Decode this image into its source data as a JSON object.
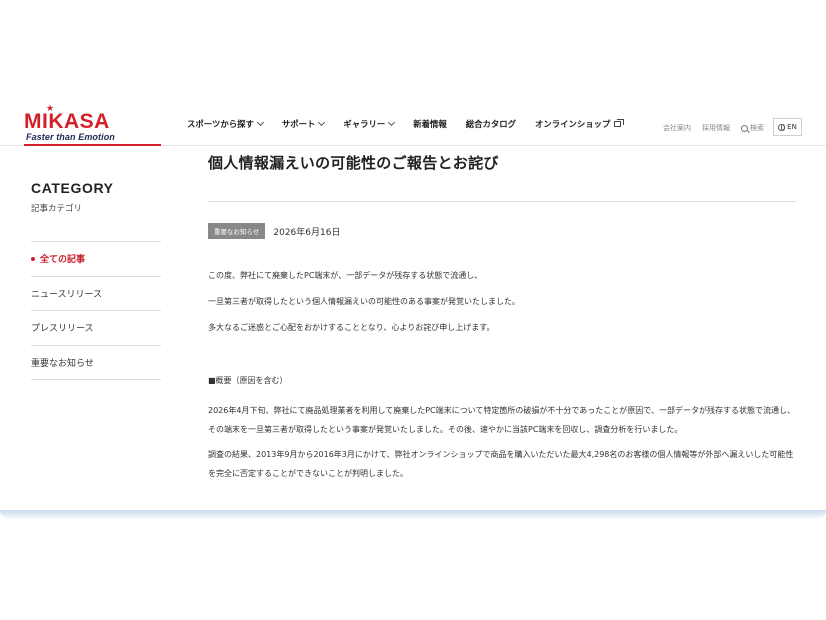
{
  "brand": {
    "logo_text": "MIKASA",
    "tagline": "Faster than Emotion",
    "color": "#d3202a"
  },
  "nav": {
    "items": [
      {
        "label": "スポーツから探す",
        "has_dropdown": true
      },
      {
        "label": "サポート",
        "has_dropdown": true
      },
      {
        "label": "ギャラリー",
        "has_dropdown": true
      },
      {
        "label": "新着情報",
        "has_dropdown": false
      },
      {
        "label": "総合カタログ",
        "has_dropdown": false
      },
      {
        "label": "オンラインショップ",
        "has_dropdown": false,
        "external": true
      }
    ]
  },
  "utility": {
    "company": "会社案内",
    "recruit": "採用情報",
    "search": "検索",
    "lang": "EN"
  },
  "sidebar": {
    "title": "CATEGORY",
    "subtitle": "記事カテゴリ",
    "items": [
      {
        "label": "全ての記事",
        "active": true
      },
      {
        "label": "ニュースリリース",
        "active": false
      },
      {
        "label": "プレスリリース",
        "active": false
      },
      {
        "label": "重要なお知らせ",
        "active": false
      }
    ]
  },
  "article": {
    "title": "個人情報漏えいの可能性のご報告とお詫び",
    "badge": "重要なお知らせ",
    "date": "2026年6月16日",
    "intro": [
      "この度、弊社にて廃棄したPC端末が、一部データが残存する状態で流通し、",
      "一旦第三者が取得したという個人情報漏えいの可能性のある事案が発覚いたしました。",
      "多大なるご迷惑とご心配をおかけすることとなり、心よりお詫び申し上げます。"
    ],
    "section_head": "■概要（原因を含む）",
    "section_paras": [
      "2026年4月下旬、弊社にて廃品処理業者を利用して廃棄したPC端末について特定箇所の破損が不十分であったことが原因で、一部データが残存する状態で流通し、その端末を一旦第三者が取得したという事案が発覚いたしました。その後、速やかに当該PC端末を回収し、調査分析を行いました。",
      "調査の結果、2013年9月から2016年3月にかけて、弊社オンラインショップで商品を購入いただいた最大4,298名のお客様の個人情報等が外部へ漏えいした可能性を完全に否定することができないことが判明しました。"
    ]
  }
}
